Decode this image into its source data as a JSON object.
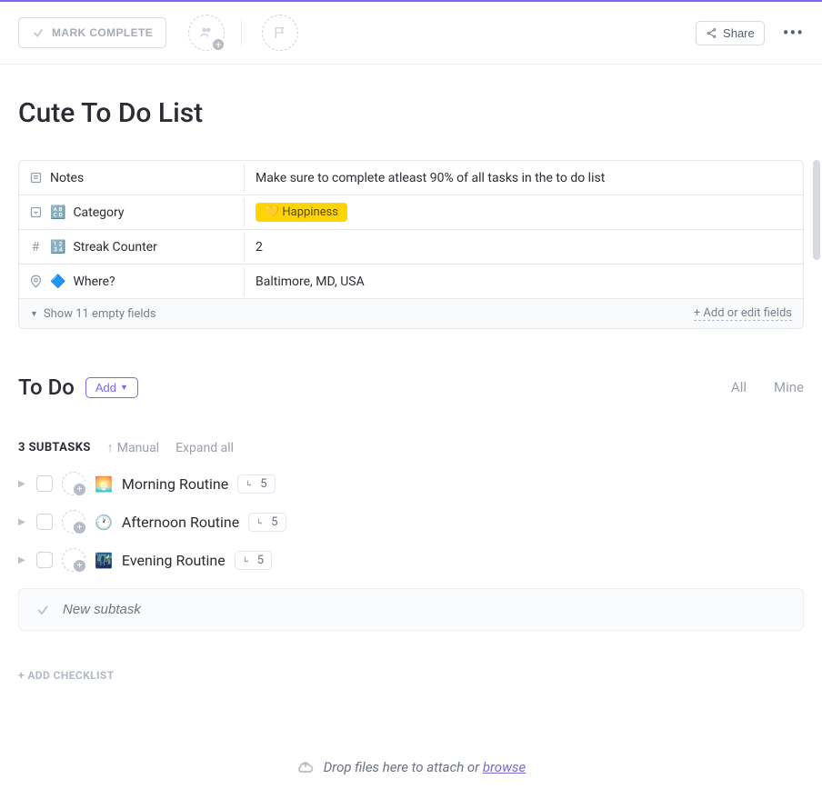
{
  "toolbar": {
    "mark_complete": "MARK COMPLETE",
    "share": "Share"
  },
  "page": {
    "title": "Cute To Do List"
  },
  "fields": {
    "notes": {
      "label": "Notes",
      "value": "Make sure to complete atleast 90% of all tasks in the to do list"
    },
    "category": {
      "label": "Category",
      "emoji": "🔠",
      "value": "💛 Happiness"
    },
    "streak": {
      "label": "Streak Counter",
      "emoji": "🔢",
      "value": "2"
    },
    "where": {
      "label": "Where?",
      "emoji": "🔷",
      "value": "Baltimore, MD, USA"
    },
    "footer": {
      "show_empty": "Show 11 empty fields",
      "add_edit": "+ Add or edit fields"
    }
  },
  "section": {
    "title": "To Do",
    "add": "Add",
    "filter_all": "All",
    "filter_mine": "Mine"
  },
  "subtasks": {
    "count_label": "3 SUBTASKS",
    "sort": "Manual",
    "expand": "Expand all",
    "items": [
      {
        "emoji": "🌅",
        "name": "Morning Routine",
        "count": "5"
      },
      {
        "emoji": "🕐",
        "name": "Afternoon Routine",
        "count": "5"
      },
      {
        "emoji": "🌃",
        "name": "Evening Routine",
        "count": "5"
      }
    ],
    "new_placeholder": "New subtask"
  },
  "checklist": {
    "add": "+ ADD CHECKLIST"
  },
  "dropzone": {
    "text": "Drop files here to attach or ",
    "browse": "browse"
  }
}
